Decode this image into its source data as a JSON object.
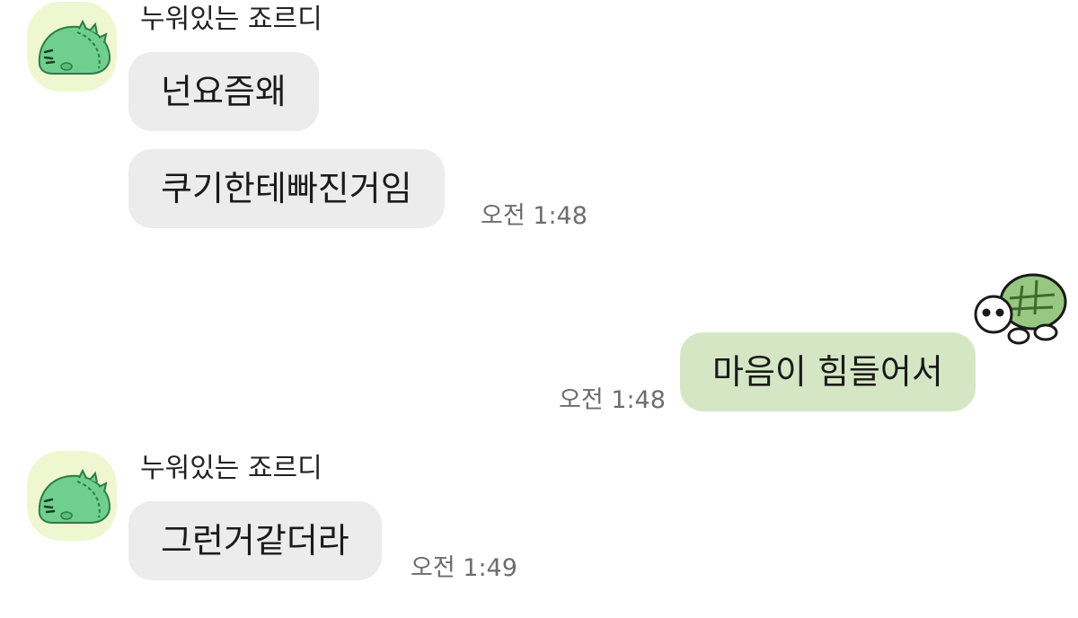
{
  "messages": [
    {
      "sender": "누워있는 죠르디",
      "bubbles": [
        "넌요즘왜",
        "쿠기한테빠진거임"
      ],
      "time": "오전 1:48",
      "avatar_icon": "jordy-dinosaur-icon"
    },
    {
      "sender": "me",
      "bubbles": [
        "마음이 힘들어서"
      ],
      "time": "오전 1:48",
      "sticker_icon": "turtle-sticker-icon"
    },
    {
      "sender": "누워있는 죠르디",
      "bubbles": [
        "그런거같더라"
      ],
      "time": "오전 1:49",
      "avatar_icon": "jordy-dinosaur-icon"
    }
  ],
  "colors": {
    "incoming_bubble": "#ececec",
    "outgoing_bubble": "#d5e6c4",
    "avatar_background": "#eef7cf",
    "timestamp_text": "#6d6d6d"
  }
}
